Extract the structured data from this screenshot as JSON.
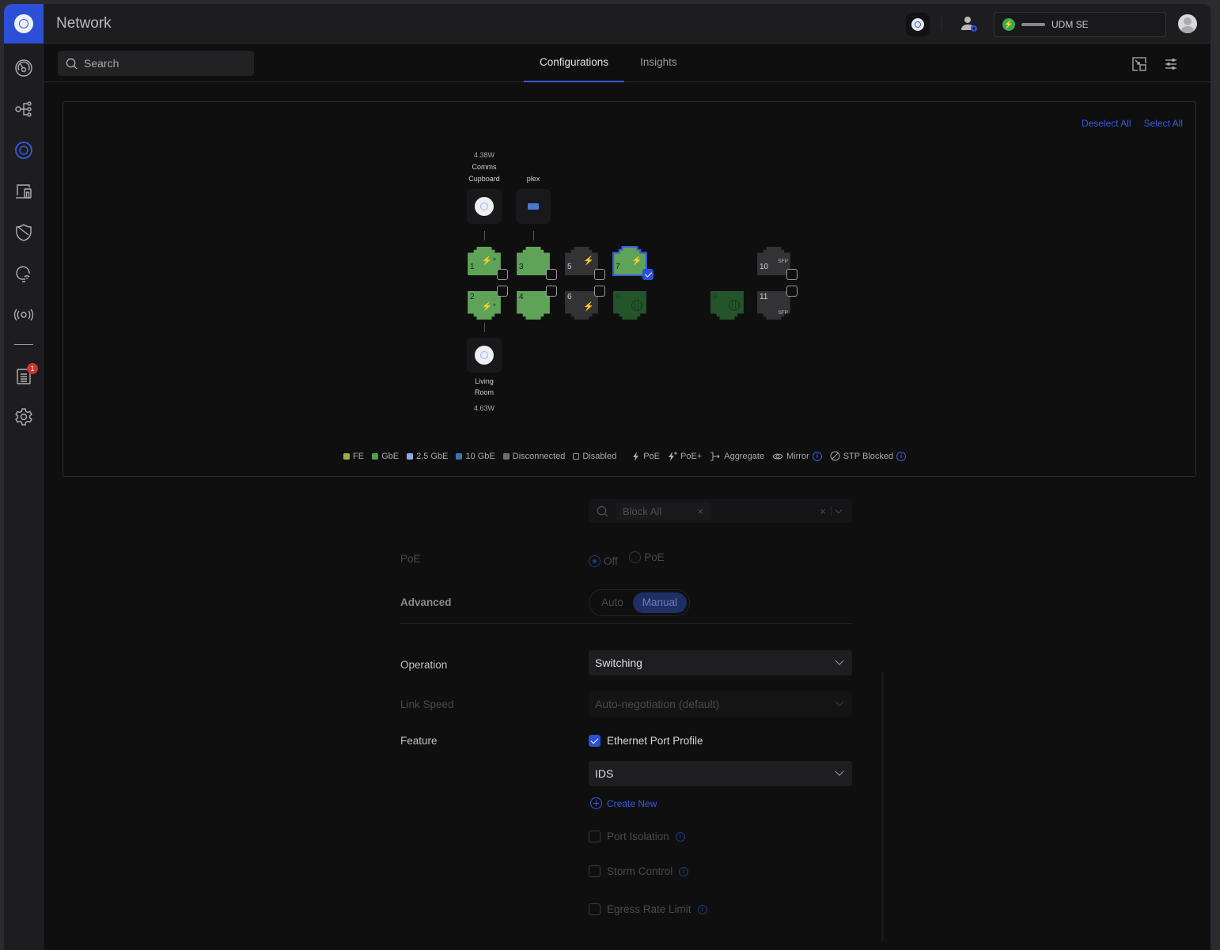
{
  "app": {
    "title": "Network"
  },
  "topbar": {
    "device_name": "UDM SE",
    "device_status_color": "#3da850"
  },
  "sidebar": {
    "items": [
      {
        "name": "dashboard",
        "icon": "gauge-icon"
      },
      {
        "name": "topology",
        "icon": "topology-icon"
      },
      {
        "name": "unifi-devices",
        "icon": "device-disk-icon",
        "active": true
      },
      {
        "name": "client-devices",
        "icon": "devices-icon"
      },
      {
        "name": "security",
        "icon": "shield-icon"
      },
      {
        "name": "insights",
        "icon": "wifi-bulb-icon"
      },
      {
        "name": "radios",
        "icon": "broadcast-icon"
      },
      {
        "name": "logs",
        "icon": "clipboard-icon",
        "badge": "1"
      },
      {
        "name": "settings",
        "icon": "gear-icon"
      }
    ]
  },
  "search": {
    "placeholder": "Search",
    "value": ""
  },
  "tabs": [
    {
      "label": "Configurations",
      "active": true
    },
    {
      "label": "Insights",
      "active": false
    }
  ],
  "panel": {
    "deselect_all": "Deselect All",
    "select_all": "Select All",
    "devices": [
      {
        "power": "4.38W",
        "name_line1": "Comms",
        "name_line2": "Cupboard",
        "type": "access-point",
        "port": 1
      },
      {
        "power": "",
        "name_line1": "",
        "name_line2": "plex",
        "type": "server",
        "port": 3
      },
      {
        "power": "4.63W",
        "name_line1": "Living",
        "name_line2": "Room",
        "type": "access-point",
        "port": 2
      }
    ],
    "ports": [
      {
        "num": "1",
        "state": "gbe",
        "poe": "poe+",
        "selected": false
      },
      {
        "num": "2",
        "state": "gbe",
        "poe": "poe+",
        "selected": false
      },
      {
        "num": "3",
        "state": "gbe",
        "poe": "",
        "selected": false
      },
      {
        "num": "4",
        "state": "gbe",
        "poe": "",
        "selected": false
      },
      {
        "num": "5",
        "state": "disconnected",
        "poe": "poe",
        "selected": false
      },
      {
        "num": "6",
        "state": "disconnected",
        "poe": "poe",
        "selected": false
      },
      {
        "num": "7",
        "state": "gbe",
        "poe": "poe",
        "selected": true
      },
      {
        "num": "8",
        "state": "wan",
        "poe": "",
        "selected": false
      },
      {
        "num": "9",
        "state": "wan",
        "poe": "",
        "selected": false
      },
      {
        "num": "10",
        "state": "disconnected",
        "poe": "",
        "sfp": "SFP",
        "selected": false
      },
      {
        "num": "11",
        "state": "disconnected",
        "poe": "",
        "sfp": "SFP",
        "selected": false
      }
    ],
    "legend": [
      {
        "label": "FE",
        "color": "#98b33c"
      },
      {
        "label": "GbE",
        "color": "#4fa04f"
      },
      {
        "label": "2.5 GbE",
        "color": "#8fa8e0"
      },
      {
        "label": "10 GbE",
        "color": "#3f73b0"
      },
      {
        "label": "Disconnected",
        "color": "#6e6e74"
      },
      {
        "label": "Disabled",
        "color": "outline"
      },
      {
        "label": "PoE",
        "icon": "bolt-icon"
      },
      {
        "label": "PoE+",
        "icon": "bolt-plus-icon"
      },
      {
        "label": "Aggregate",
        "icon": "aggregate-icon"
      },
      {
        "label": "Mirror",
        "icon": "eye-icon",
        "info": true
      },
      {
        "label": "STP Blocked",
        "icon": "blocked-icon",
        "info": true
      }
    ]
  },
  "form": {
    "traffic_restriction": {
      "tag": "Block All",
      "tag_remove": "×",
      "clear": "×"
    },
    "poe": {
      "label": "PoE",
      "options": [
        "Off",
        "PoE"
      ],
      "selected": "Off"
    },
    "advanced": {
      "label": "Advanced",
      "options": [
        "Auto",
        "Manual"
      ],
      "selected": "Manual"
    },
    "operation": {
      "label": "Operation",
      "value": "Switching"
    },
    "link_speed": {
      "label": "Link Speed",
      "value": "Auto-negotiation (default)"
    },
    "feature": {
      "label": "Feature",
      "ethernet_port_profile": {
        "label": "Ethernet Port Profile",
        "checked": true
      },
      "profile_value": "IDS",
      "create_new": "Create New",
      "port_isolation": {
        "label": "Port Isolation",
        "checked": false
      },
      "storm_control": {
        "label": "Storm Control",
        "checked": false
      },
      "egress_rate_limit": {
        "label": "Egress Rate Limit",
        "checked": false
      }
    }
  }
}
